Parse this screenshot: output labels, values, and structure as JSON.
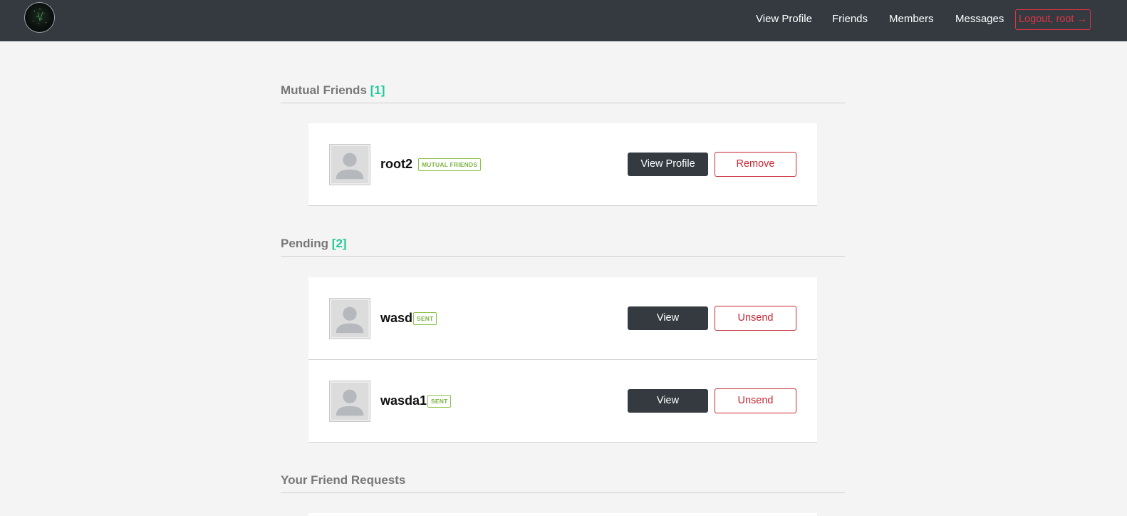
{
  "nav": {
    "links": [
      "View Profile",
      "Friends",
      "Members",
      "Messages"
    ],
    "logout_label": "Logout, root →"
  },
  "colors": {
    "navbar_bg": "#343a40",
    "accent_count": "#20c997",
    "danger": "#dc3545",
    "badge_green": "#8bc34a"
  },
  "sections": {
    "mutual": {
      "title": "Mutual Friends",
      "count": "[1]",
      "items": [
        {
          "name": "root2",
          "badge": "MUTUAL FRIENDS",
          "primary_label": "View Profile",
          "secondary_label": "Remove"
        }
      ]
    },
    "pending": {
      "title": "Pending",
      "count": "[2]",
      "items": [
        {
          "name": "wasd",
          "badge": "SENT",
          "primary_label": "View",
          "secondary_label": "Unsend"
        },
        {
          "name": "wasda1",
          "badge": "SENT",
          "primary_label": "View",
          "secondary_label": "Unsend"
        }
      ]
    },
    "requests": {
      "title": "Your Friend Requests"
    }
  },
  "icons": {
    "logo": "site-logo",
    "avatar": "default-user-avatar-icon"
  }
}
